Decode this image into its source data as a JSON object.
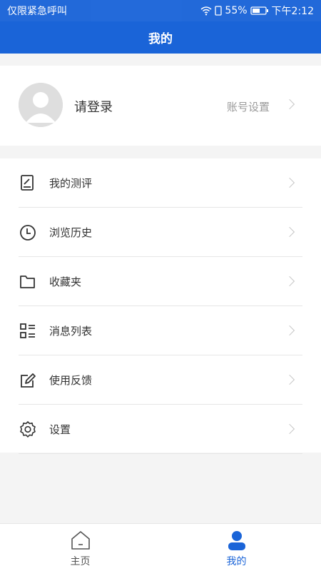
{
  "status": {
    "left_text": "仅限紧急呼叫",
    "battery": "55%",
    "time": "下午2:12"
  },
  "header": {
    "title": "我的"
  },
  "profile": {
    "login_label": "请登录",
    "account_settings_label": "账号设置"
  },
  "menu": [
    {
      "label": "我的测评",
      "icon": "assessment-icon"
    },
    {
      "label": "浏览历史",
      "icon": "clock-icon"
    },
    {
      "label": "收藏夹",
      "icon": "folder-icon"
    },
    {
      "label": "消息列表",
      "icon": "list-icon"
    },
    {
      "label": "使用反馈",
      "icon": "edit-icon"
    },
    {
      "label": "设置",
      "icon": "gear-icon"
    }
  ],
  "tabbar": {
    "home_label": "主页",
    "mine_label": "我的"
  },
  "colors": {
    "primary": "#1a64d8",
    "tab_inactive": "#555555"
  }
}
